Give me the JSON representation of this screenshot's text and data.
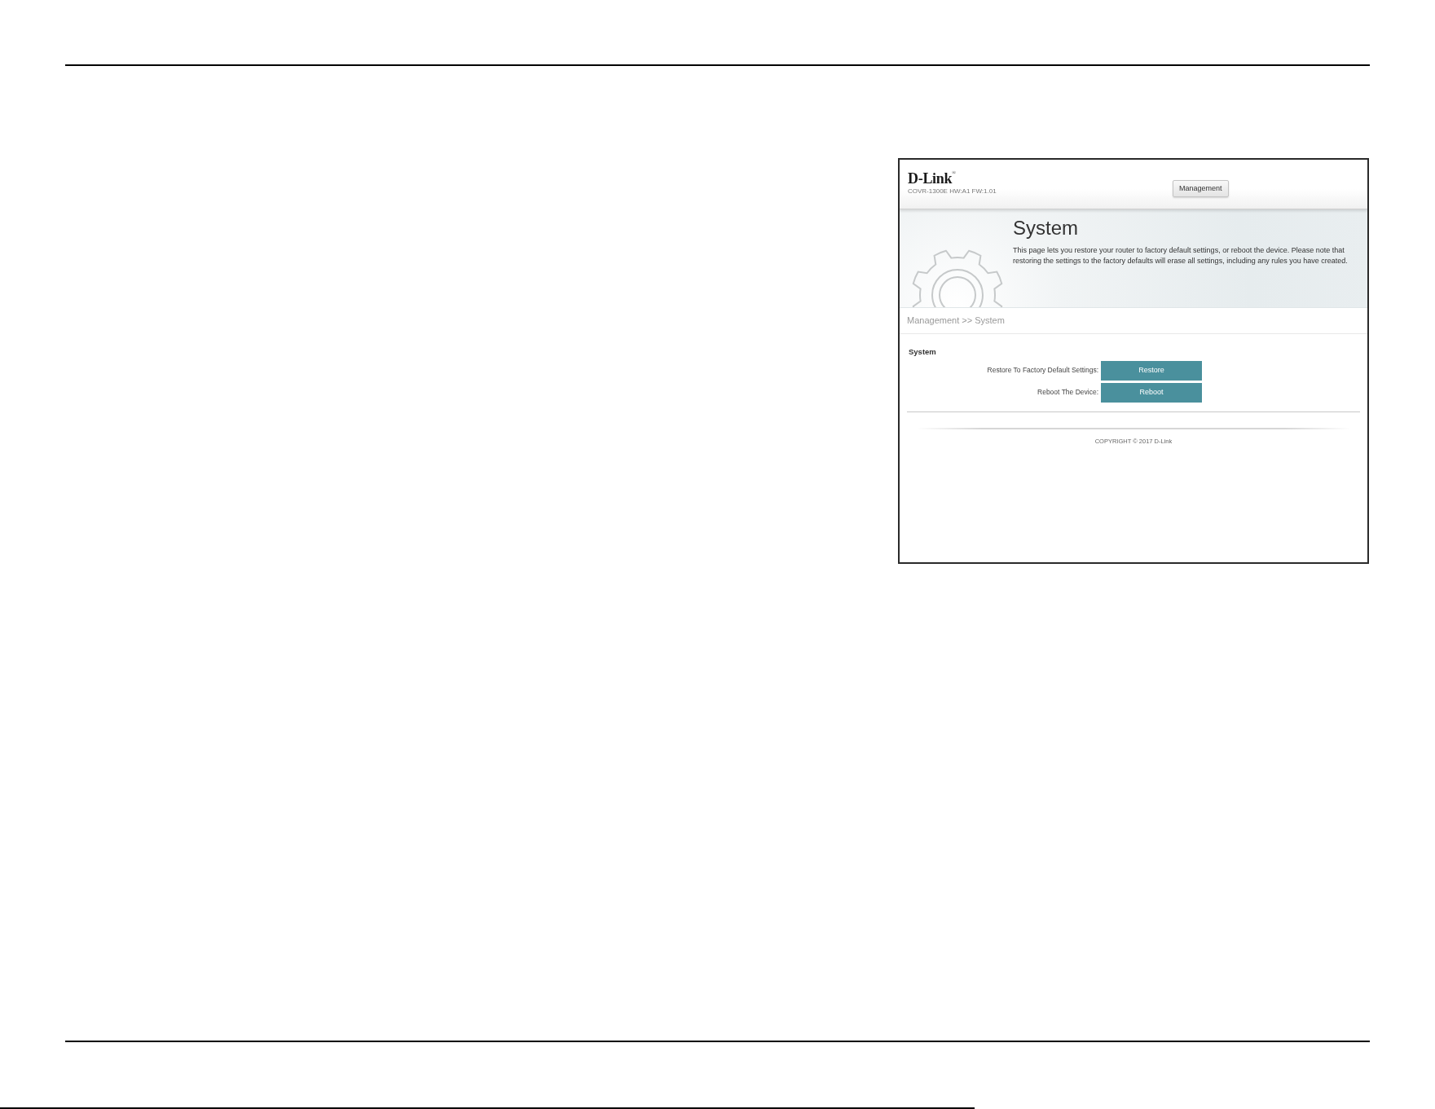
{
  "screenshot": {
    "logo": "D-Link$^{®}$",
    "model_info": "COVR-1300E HW:A1 FW:1.01",
    "nav_tabs": [
      {
        "label": "Management",
        "selected": true
      }
    ],
    "banner": {
      "title": "System",
      "description": "This page lets you restore your router to factory default settings, or reboot the device. Please note that restoring the settings to the factory defaults will erase all settings, including any rules you have created."
    },
    "breadcrumb": "Management >> System",
    "section": {
      "title": "System",
      "rows": [
        {
          "label": "Restore To Factory Default Settings:",
          "button": "Restore"
        },
        {
          "label": "Reboot The Device:",
          "button": "Reboot"
        }
      ]
    },
    "copyright": "COPYRIGHT © 2017 D-Link"
  }
}
